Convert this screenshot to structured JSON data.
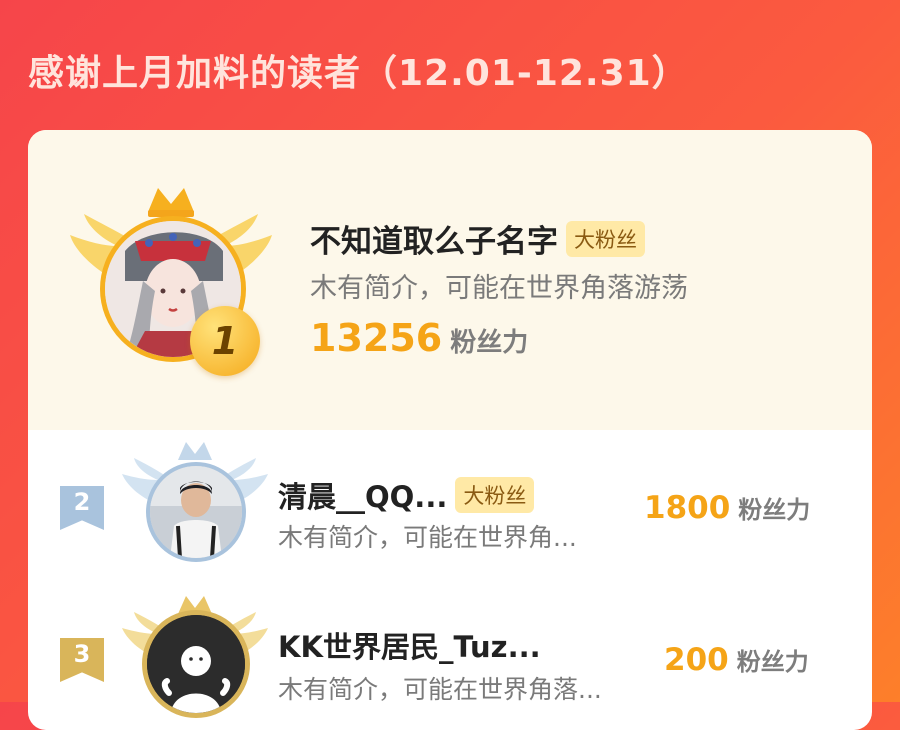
{
  "header": {
    "title": "感谢上月加料的读者（12.01-12.31）"
  },
  "readers": [
    {
      "rank": "1",
      "name": "不知道取么子名字",
      "badge": "大粉丝",
      "bio": "木有简介，可能在世界角落游荡",
      "score": "13256",
      "score_unit": "粉丝力"
    },
    {
      "rank": "2",
      "name": "清晨__QQ...",
      "badge": "大粉丝",
      "bio": "木有简介，可能在世界角...",
      "score": "1800",
      "score_unit": "粉丝力"
    },
    {
      "rank": "3",
      "name": "KK世界居民_Tuz...",
      "badge": "",
      "bio": "木有简介，可能在世界角落...",
      "score": "200",
      "score_unit": "粉丝力"
    }
  ],
  "colors": {
    "background_start": "#f6454a",
    "background_end": "#fd7f2a",
    "score": "#f5a417",
    "badge_bg": "#ffe9a6",
    "gold": "#f6b01f",
    "silver": "#a9c3dd",
    "bronze": "#d9b55a"
  },
  "icons": {
    "rank1": "crown-wings-gold-icon",
    "rank2": "crown-wings-silver-icon",
    "rank3": "crown-wings-bronze-icon",
    "medal": "medal-1-icon"
  }
}
